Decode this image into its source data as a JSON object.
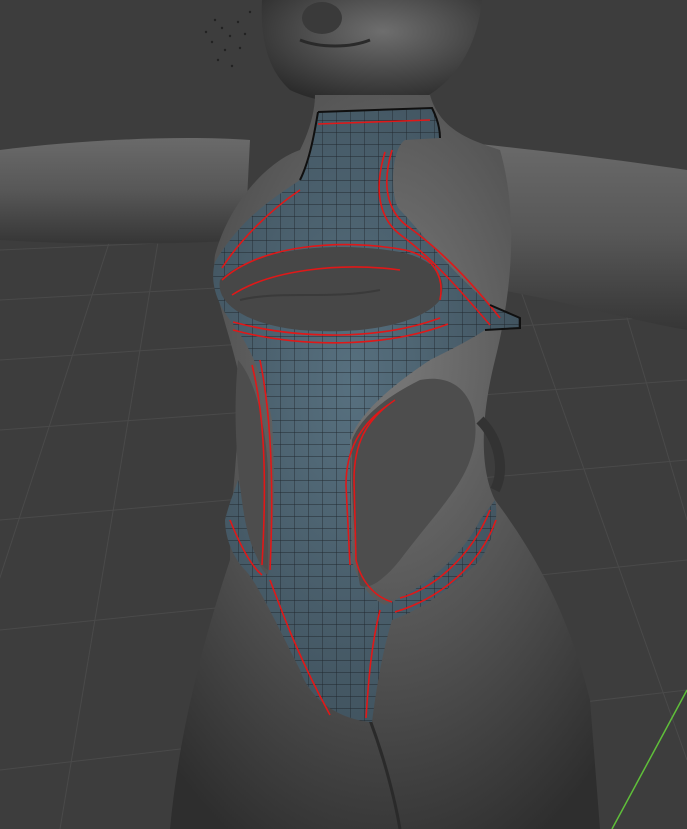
{
  "viewport": {
    "view": "3D viewport",
    "background_color": "#3d3d3d",
    "grid_line_color": "#4a4a4a",
    "axis_y_color": "#5fbf3a"
  },
  "model": {
    "body_color": "#5a5a5a",
    "garment_color": "#4a5f6e",
    "wire_color": "#1a1f24",
    "seam_color": "#e01818"
  }
}
